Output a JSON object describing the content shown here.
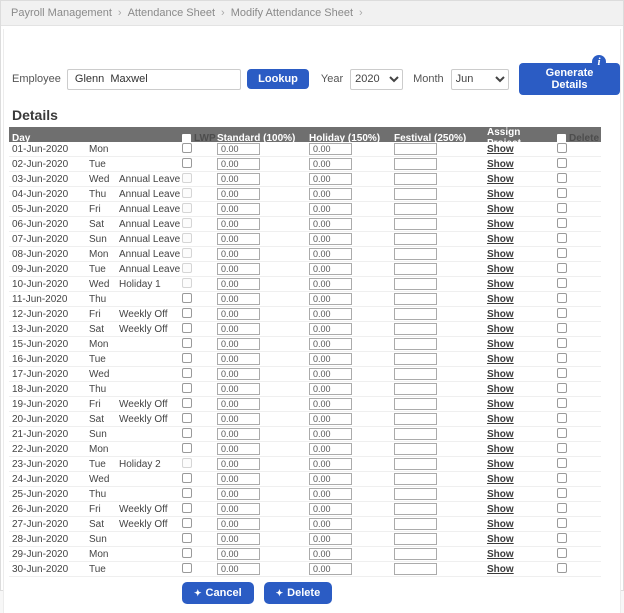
{
  "breadcrumb": {
    "separator": "›",
    "items": [
      "Payroll Management",
      "Attendance Sheet",
      "Modify Attendance Sheet"
    ]
  },
  "icons": {
    "info": "i",
    "diamond": "✦"
  },
  "form": {
    "employee_label": "Employee",
    "employee_value": "Glenn  Maxwel",
    "lookup_label": "Lookup",
    "year_label": "Year",
    "year_value": "2020",
    "month_label": "Month",
    "month_value": "Jun",
    "generate_label": "Generate Details"
  },
  "details": {
    "title": "Details"
  },
  "table": {
    "headers": {
      "day": "Day",
      "lwp": "LWP",
      "standard": "Standard (100%)",
      "holiday": "Holiday (150%)",
      "festival": "Festival (250%)",
      "assign_project": "Assign Project",
      "delete": "Delete"
    },
    "show_label": "Show",
    "rows": [
      {
        "date": "01-Jun-2020",
        "day": "Mon",
        "leave": "",
        "lwp_disabled": false,
        "standard": "0.00",
        "holiday": "0.00",
        "festival": ""
      },
      {
        "date": "02-Jun-2020",
        "day": "Tue",
        "leave": "",
        "lwp_disabled": false,
        "standard": "0.00",
        "holiday": "0.00",
        "festival": ""
      },
      {
        "date": "03-Jun-2020",
        "day": "Wed",
        "leave": "Annual Leave",
        "lwp_disabled": true,
        "standard": "0.00",
        "holiday": "0.00",
        "festival": ""
      },
      {
        "date": "04-Jun-2020",
        "day": "Thu",
        "leave": "Annual Leave",
        "lwp_disabled": true,
        "standard": "0.00",
        "holiday": "0.00",
        "festival": ""
      },
      {
        "date": "05-Jun-2020",
        "day": "Fri",
        "leave": "Annual Leave",
        "lwp_disabled": true,
        "standard": "0.00",
        "holiday": "0.00",
        "festival": ""
      },
      {
        "date": "06-Jun-2020",
        "day": "Sat",
        "leave": "Annual Leave",
        "lwp_disabled": true,
        "standard": "0.00",
        "holiday": "0.00",
        "festival": ""
      },
      {
        "date": "07-Jun-2020",
        "day": "Sun",
        "leave": "Annual Leave",
        "lwp_disabled": true,
        "standard": "0.00",
        "holiday": "0.00",
        "festival": ""
      },
      {
        "date": "08-Jun-2020",
        "day": "Mon",
        "leave": "Annual Leave",
        "lwp_disabled": true,
        "standard": "0.00",
        "holiday": "0.00",
        "festival": ""
      },
      {
        "date": "09-Jun-2020",
        "day": "Tue",
        "leave": "Annual Leave",
        "lwp_disabled": true,
        "standard": "0.00",
        "holiday": "0.00",
        "festival": ""
      },
      {
        "date": "10-Jun-2020",
        "day": "Wed",
        "leave": "Holiday 1",
        "lwp_disabled": true,
        "standard": "0.00",
        "holiday": "0.00",
        "festival": ""
      },
      {
        "date": "11-Jun-2020",
        "day": "Thu",
        "leave": "",
        "lwp_disabled": false,
        "standard": "0.00",
        "holiday": "0.00",
        "festival": ""
      },
      {
        "date": "12-Jun-2020",
        "day": "Fri",
        "leave": "Weekly Off",
        "lwp_disabled": false,
        "standard": "0.00",
        "holiday": "0.00",
        "festival": ""
      },
      {
        "date": "13-Jun-2020",
        "day": "Sat",
        "leave": "Weekly Off",
        "lwp_disabled": false,
        "standard": "0.00",
        "holiday": "0.00",
        "festival": ""
      },
      {
        "date": "15-Jun-2020",
        "day": "Mon",
        "leave": "",
        "lwp_disabled": false,
        "standard": "0.00",
        "holiday": "0.00",
        "festival": ""
      },
      {
        "date": "16-Jun-2020",
        "day": "Tue",
        "leave": "",
        "lwp_disabled": false,
        "standard": "0.00",
        "holiday": "0.00",
        "festival": ""
      },
      {
        "date": "17-Jun-2020",
        "day": "Wed",
        "leave": "",
        "lwp_disabled": false,
        "standard": "0.00",
        "holiday": "0.00",
        "festival": ""
      },
      {
        "date": "18-Jun-2020",
        "day": "Thu",
        "leave": "",
        "lwp_disabled": false,
        "standard": "0.00",
        "holiday": "0.00",
        "festival": ""
      },
      {
        "date": "19-Jun-2020",
        "day": "Fri",
        "leave": "Weekly Off",
        "lwp_disabled": false,
        "standard": "0.00",
        "holiday": "0.00",
        "festival": ""
      },
      {
        "date": "20-Jun-2020",
        "day": "Sat",
        "leave": "Weekly Off",
        "lwp_disabled": false,
        "standard": "0.00",
        "holiday": "0.00",
        "festival": ""
      },
      {
        "date": "21-Jun-2020",
        "day": "Sun",
        "leave": "",
        "lwp_disabled": false,
        "standard": "0.00",
        "holiday": "0.00",
        "festival": ""
      },
      {
        "date": "22-Jun-2020",
        "day": "Mon",
        "leave": "",
        "lwp_disabled": false,
        "standard": "0.00",
        "holiday": "0.00",
        "festival": ""
      },
      {
        "date": "23-Jun-2020",
        "day": "Tue",
        "leave": "Holiday 2",
        "lwp_disabled": true,
        "standard": "0.00",
        "holiday": "0.00",
        "festival": ""
      },
      {
        "date": "24-Jun-2020",
        "day": "Wed",
        "leave": "",
        "lwp_disabled": false,
        "standard": "0.00",
        "holiday": "0.00",
        "festival": ""
      },
      {
        "date": "25-Jun-2020",
        "day": "Thu",
        "leave": "",
        "lwp_disabled": false,
        "standard": "0.00",
        "holiday": "0.00",
        "festival": ""
      },
      {
        "date": "26-Jun-2020",
        "day": "Fri",
        "leave": "Weekly Off",
        "lwp_disabled": false,
        "standard": "0.00",
        "holiday": "0.00",
        "festival": ""
      },
      {
        "date": "27-Jun-2020",
        "day": "Sat",
        "leave": "Weekly Off",
        "lwp_disabled": false,
        "standard": "0.00",
        "holiday": "0.00",
        "festival": ""
      },
      {
        "date": "28-Jun-2020",
        "day": "Sun",
        "leave": "",
        "lwp_disabled": false,
        "standard": "0.00",
        "holiday": "0.00",
        "festival": ""
      },
      {
        "date": "29-Jun-2020",
        "day": "Mon",
        "leave": "",
        "lwp_disabled": false,
        "standard": "0.00",
        "holiday": "0.00",
        "festival": ""
      },
      {
        "date": "30-Jun-2020",
        "day": "Tue",
        "leave": "",
        "lwp_disabled": false,
        "standard": "0.00",
        "holiday": "0.00",
        "festival": ""
      }
    ]
  },
  "footer": {
    "cancel_label": "Cancel",
    "delete_label": "Delete"
  },
  "colors": {
    "accent": "#2b5cc4",
    "table_header_bg": "#6f6f6f"
  }
}
